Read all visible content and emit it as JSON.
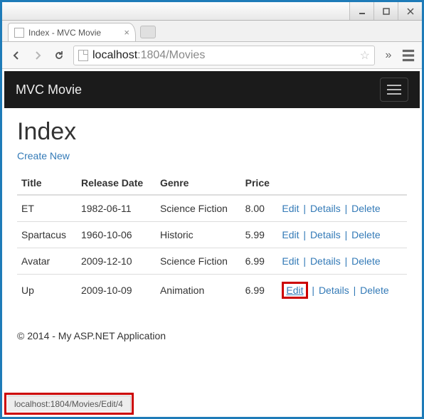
{
  "window": {
    "tab_title": "Index - MVC Movie"
  },
  "address": {
    "host": "localhost",
    "port_path": ":1804/Movies"
  },
  "navbar": {
    "brand": "MVC Movie"
  },
  "page": {
    "heading": "Index",
    "create_link": "Create New",
    "columns": {
      "title": "Title",
      "release": "Release Date",
      "genre": "Genre",
      "price": "Price"
    },
    "actions": {
      "edit": "Edit",
      "details": "Details",
      "delete": "Delete",
      "sep": " | "
    },
    "rows": [
      {
        "title": "ET",
        "release": "1982-06-11",
        "genre": "Science Fiction",
        "price": "8.00"
      },
      {
        "title": "Spartacus",
        "release": "1960-10-06",
        "genre": "Historic",
        "price": "5.99"
      },
      {
        "title": "Avatar",
        "release": "2009-12-10",
        "genre": "Science Fiction",
        "price": "6.99"
      },
      {
        "title": "Up",
        "release": "2009-10-09",
        "genre": "Animation",
        "price": "6.99"
      }
    ],
    "footer": "© 2014 - My ASP.NET Application"
  },
  "status": {
    "text": "localhost:1804/Movies/Edit/4"
  }
}
